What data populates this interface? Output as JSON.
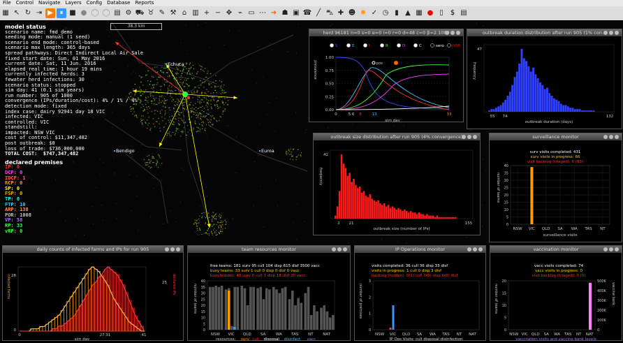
{
  "menu": [
    "File",
    "Control",
    "Navigate",
    "Layers",
    "Config",
    "Database",
    "Reports"
  ],
  "toolbar_icons": [
    "grid-icon",
    "cursor-icon",
    "refresh-icon",
    "step-icon",
    "play-icon",
    "pause-icon",
    "stop-icon",
    "record-icon",
    "disabled-a-icon",
    "disabled-b-icon",
    "notes-icon",
    "settings-icon",
    "truck-icon",
    "cow-icon",
    "paint-icon",
    "gavel-icon",
    "house-icon",
    "filter-icon",
    "zoom-in-icon",
    "zoom-out-icon",
    "pan-icon",
    "antenna-icon",
    "screen-icon",
    "dots-icon",
    "arrow-icon",
    "person-icon",
    "bus-icon",
    "phone-icon",
    "pen-icon",
    "vehicle-icon",
    "syringe-icon",
    "people-icon",
    "virus-icon",
    "check-icon",
    "clock-icon",
    "chart-icon",
    "graph-icon",
    "calendar-icon",
    "balloon-icon",
    "blank-icon",
    "money-icon",
    "doc-icon"
  ],
  "status": {
    "heading": "model status",
    "lines": [
      "scenario name: fmd_demo",
      "seeding mode: manual (1 seed)",
      "scenario end mode: control-based",
      "scenario max length: 365 days",
      "spread pathways: Direct Indirect Local Air Sale",
      "fixed start date: Sun, 01 May 2016",
      "current date: Sat, 11 Jun. 2016",
      "elapsed real time: 1 hour 19 mins",
      "currently infected herds: 3",
      "fewater herd infections: 30",
      "scenario status: stopped",
      "sim day: 41 (0.1 sim years)",
      "run number: 905 of 1000",
      "convergence (IPs/duration/cost): 4% / 1% / 4%",
      "detection mode: fixed",
      "index case: dairy 92941 day 18 VIC",
      "infected: VIC",
      "controlled: VIC",
      "standstill:",
      "impacted: NSW VIC",
      "cost of control: $11,347,482",
      "post outbreak: $0",
      "loss of trade: $736,000,000",
      "TOTAL COST:  $747,347,482"
    ],
    "declared_heading": "declared premises",
    "declared": [
      {
        "k": "IP:",
        "v": "0",
        "c": "#ff3030"
      },
      {
        "k": "DCP:",
        "v": "0",
        "c": "#ff40ff"
      },
      {
        "k": "IDCP:",
        "v": "1",
        "c": "#ff6060"
      },
      {
        "k": "RCP:",
        "v": "0",
        "c": "#ff9900"
      },
      {
        "k": "SP:",
        "v": "0",
        "c": "#ffff00"
      },
      {
        "k": "FSP:",
        "v": "0",
        "c": "#ffa500"
      },
      {
        "k": "TP:",
        "v": "0",
        "c": "#00ffff"
      },
      {
        "k": "FTP:",
        "v": "10",
        "c": "#40c0ff"
      },
      {
        "k": "ARP:",
        "v": "138",
        "c": "#ff8c40"
      },
      {
        "k": "POR:",
        "v": "1008",
        "c": "#c0c0c0"
      },
      {
        "k": "VP:",
        "v": "58",
        "c": "#b070ff"
      },
      {
        "k": "RP:",
        "v": "33",
        "c": "#40ff40"
      },
      {
        "k": "vRP:",
        "v": "0",
        "c": "#40ff40"
      }
    ]
  },
  "map": {
    "scale_label": "38.3 km",
    "towns": [
      "Echuca",
      "Bendigo",
      "Euroa"
    ]
  },
  "herd_panel": {
    "title": "herd 96181 n=0 s=0 e=0 i=0 r=0 d=48 c=0 β=2.1000",
    "legend": [
      "S",
      "E",
      "I",
      "R",
      "D",
      "C",
      "sero",
      "NSP"
    ],
    "legend_colors": [
      "#3050ff",
      "#40c0ff",
      "#ff3030",
      "#40ff40",
      "#ff40ff",
      "#ffffff",
      "#ffffff",
      "#ff0000"
    ],
    "ylabel": "prevalence",
    "yticks": [
      "1.00",
      "0.75",
      "0.50",
      "0.25",
      "0.00"
    ],
    "xticks": [
      "0",
      "5 6",
      "8",
      "13",
      "33"
    ],
    "xlabel": "sim day",
    "mini_label": "pos"
  },
  "duration_panel": {
    "title": "outbreak duration distribution after run 905 (1% con...",
    "ylabel": "frequency",
    "yval": "47",
    "xticks": [
      "55",
      "74",
      "132"
    ],
    "xlabel": "outbreak duration (days)",
    "bars": [
      1,
      2,
      2,
      3,
      4,
      5,
      7,
      9,
      12,
      15,
      20,
      26,
      30,
      36,
      47,
      40,
      38,
      34,
      30,
      33,
      28,
      25,
      22,
      20,
      17,
      18,
      14,
      12,
      10,
      9,
      8,
      6,
      5,
      5,
      4,
      3,
      3,
      2,
      2,
      2,
      1,
      1,
      1,
      1,
      1,
      1
    ]
  },
  "size_panel": {
    "title": "outbreak size distribution after run 905 (4% convergence)",
    "ylabel": "frequency",
    "yval": "42",
    "xticks": [
      "2",
      "21",
      "155"
    ],
    "xlabel": "outbreak size (number of IPs)",
    "bars": [
      2,
      8,
      18,
      42,
      36,
      33,
      28,
      30,
      24,
      26,
      22,
      20,
      21,
      17,
      18,
      15,
      14,
      16,
      13,
      12,
      11,
      12,
      10,
      9,
      10,
      8,
      9,
      7,
      8,
      7,
      6,
      7,
      6,
      5,
      6,
      5,
      4,
      5,
      4,
      4,
      3,
      4,
      3,
      3,
      2,
      3,
      2,
      2,
      2,
      1,
      2,
      1,
      1,
      1,
      1,
      1,
      1,
      1,
      1,
      1
    ]
  },
  "surveillance": {
    "title": "surveillance monitor",
    "lines": [
      "surv visits completed: 431",
      "surv visits in progress: 66",
      "visit backlog (triaged): 0 (83)"
    ],
    "line_colors": [
      "#ffffff",
      "#ffcc00",
      "#ff3030"
    ],
    "ylabel": "number of teams",
    "yticks": [
      "40",
      "35",
      "30",
      "25",
      "20",
      "15",
      "10",
      "5",
      "0"
    ],
    "states": [
      "NSW",
      "VIC",
      "QLD",
      "SA",
      "WA",
      "TAS",
      "NT"
    ],
    "values": [
      0,
      39,
      0,
      0,
      0,
      0,
      0
    ],
    "ymax": 40,
    "footer": "surveillance visits"
  },
  "daily_counts": {
    "title": "daily counts of infected farms and IPs for run 905",
    "ylabel": "infected farms",
    "ylabel_right": "declared IPs",
    "y_top": "28",
    "y_top_right": "25",
    "y_zero": "0",
    "xticks": [
      "0",
      "27 31",
      "41"
    ],
    "xlabel": "sim day",
    "infected": [
      0,
      0,
      0,
      0,
      1,
      1,
      1,
      2,
      2,
      3,
      4,
      5,
      6,
      7,
      9,
      11,
      13,
      15,
      17,
      19,
      21,
      23,
      25,
      27,
      28,
      27,
      26,
      24,
      22,
      20,
      17,
      14,
      12,
      10,
      8,
      6,
      4,
      3,
      2,
      1,
      0,
      0
    ],
    "ips": [
      0,
      0,
      0,
      0,
      0,
      0,
      0,
      0,
      0,
      0,
      0,
      1,
      1,
      2,
      2,
      3,
      4,
      5,
      6,
      8,
      10,
      12,
      14,
      16,
      18,
      19,
      21,
      22,
      24,
      25,
      24,
      23,
      22,
      20,
      18,
      15,
      12,
      9,
      6,
      4,
      2,
      0
    ]
  },
  "team_resources": {
    "title": "team resources monitor",
    "free_label": "free teams:",
    "free_values": [
      "181 surv",
      "95 cull",
      "104 disp",
      "615 disf",
      "3500 vacc"
    ],
    "busy_label": "busy teams:",
    "busy_values": [
      "33 surv",
      "1 cull",
      "0 disp",
      "0 disf",
      "0 vacc"
    ],
    "busy_hidden": "busy/hidden: 40 surv 0 cull 3 disp 18 disf 20 vacc",
    "ylabel": "number of teams",
    "yticks": [
      "40",
      "35",
      "30",
      "25",
      "20",
      "15",
      "10",
      "5",
      "0"
    ],
    "states": [
      "NSW",
      "VIC",
      "QLD",
      "SA",
      "WA",
      "TAS",
      "NT",
      "NAT"
    ],
    "groups": [
      [
        35,
        35,
        36,
        35,
        36
      ],
      [
        33,
        34,
        3,
        35,
        35
      ],
      [
        36,
        34,
        20,
        35,
        35
      ],
      [
        34,
        35,
        25,
        34,
        33
      ],
      [
        35,
        33,
        30,
        34,
        35
      ],
      [
        25,
        32,
        20,
        26,
        22
      ],
      [
        30,
        35,
        12,
        20,
        15
      ],
      [
        18,
        20,
        15,
        10,
        12
      ]
    ],
    "highlight": {
      "state": 1,
      "value": 32
    },
    "footer": "resources: surv cull disposal disinfect vacc",
    "footer_colors": [
      "#ff9900",
      "#ff3030",
      "#ffffff",
      "#40c0ff",
      "#b070ff"
    ]
  },
  "ip_ops": {
    "title": "IP Operations monitor",
    "lines": [
      "visits completed:  36 cull  36 disp  33 disf",
      "visits in progress:  1 cull  0 disp  3 disf",
      "backlog (hidden): 0(1) cull  0(0) disp  0(0) disf"
    ],
    "line_colors": [
      "#ffffff",
      "#ffcc00",
      "#ff3030"
    ],
    "ylabel": "number of premises",
    "yticks": [
      "3",
      "2",
      "1",
      "0"
    ],
    "states": [
      "NSW",
      "VIC",
      "QLD",
      "SA",
      "WA",
      "TAS",
      "NT",
      "NAT"
    ],
    "values": [
      0,
      1.5,
      0,
      0,
      0,
      0,
      0,
      0
    ],
    "footer": "IP Ops Visits: cull disposal disinfection"
  },
  "vaccination": {
    "title": "vaccination monitor",
    "lines": [
      "vacc visits completed:  74",
      "vacc visits in progress:  0",
      "visit backlog (triaged): 0 (0)"
    ],
    "line_colors": [
      "#ffffff",
      "#ffcc00",
      "#ff3030"
    ],
    "ylabel": "number of teams",
    "yticks": [
      "20",
      "15",
      "10",
      "5",
      "0"
    ],
    "right_ticks": [
      "500K",
      "400K",
      "300K",
      "200K",
      "100K",
      "0"
    ],
    "right_label": "vaccine bank",
    "states": [
      "NSW",
      "VIC",
      "QLD",
      "SA",
      "WA",
      "TAS",
      "NT",
      "NAT"
    ],
    "bank_value": 480,
    "footer": "vaccination visits and vaccine bank levels"
  }
}
